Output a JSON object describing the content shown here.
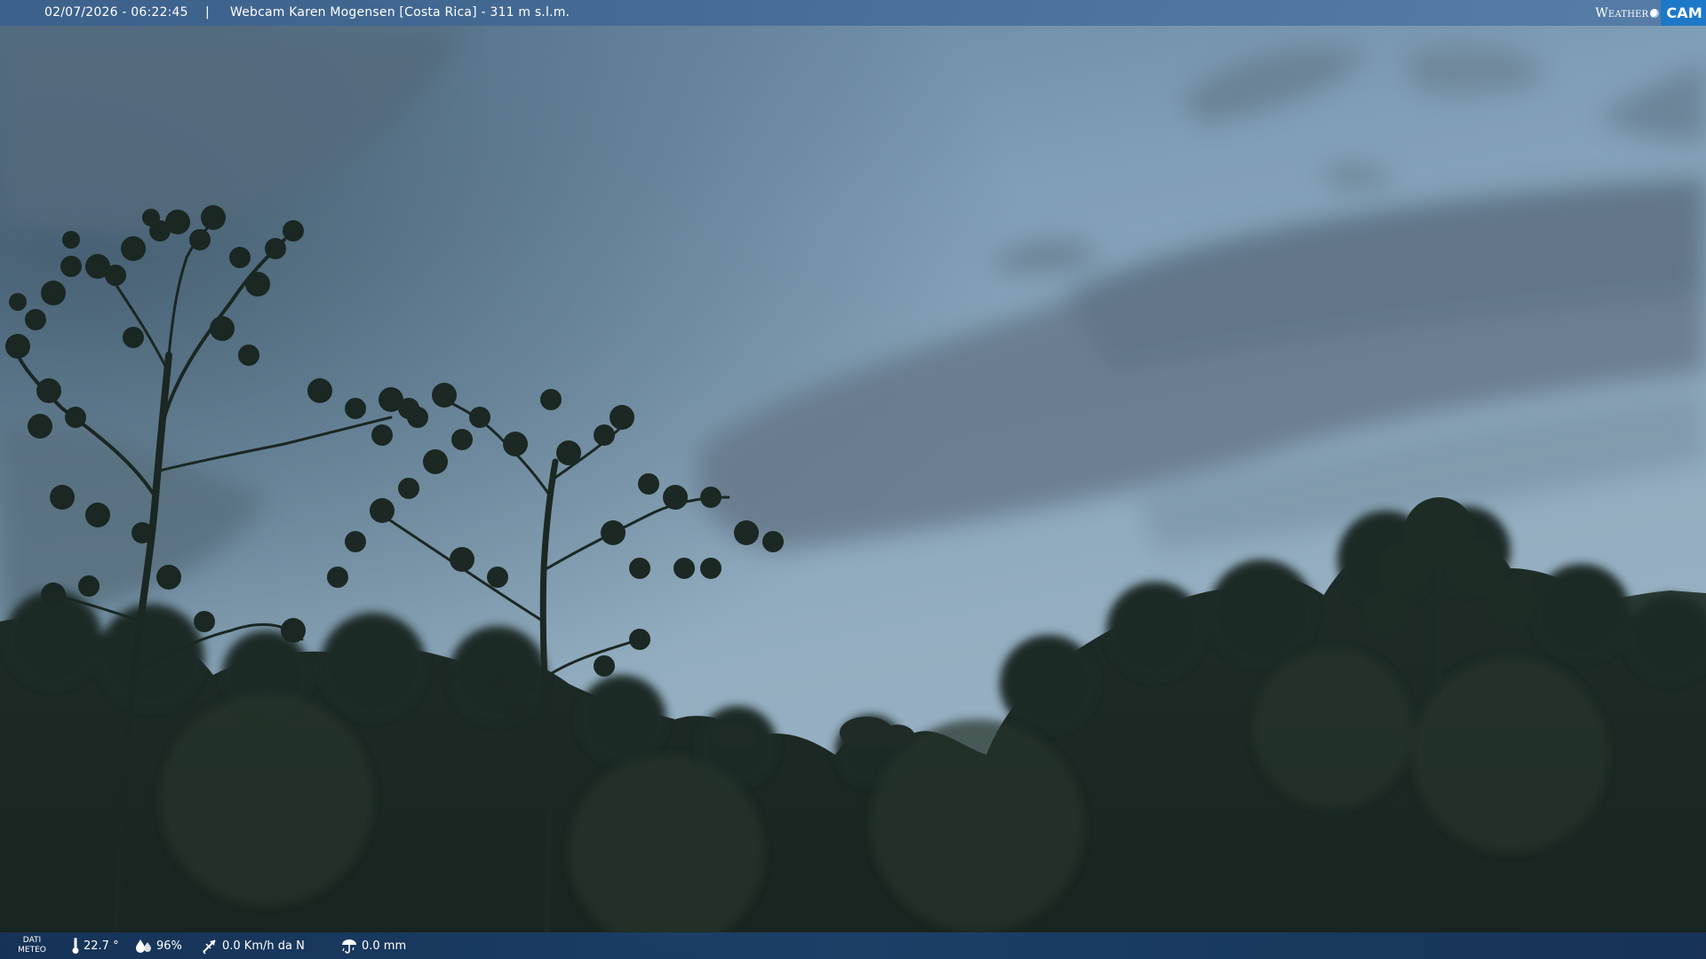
{
  "overlay": {
    "datetime": "02/07/2026 - 06:22:45",
    "separator": "|",
    "title": "Webcam Karen Mogensen [Costa Rica]  - 311 m s.l.m.",
    "logo": {
      "word": "Weather",
      "badge": "CAM"
    }
  },
  "weather": {
    "section_label_line1": "DATI",
    "section_label_line2": "METEO",
    "temperature": "22.7 °",
    "humidity": "96%",
    "wind": "0.0 Km/h da N",
    "rain": "0.0 mm",
    "icons": [
      "thermometer-icon",
      "humidity-drops-icon",
      "wind-vane-icon",
      "rain-gauge-icon"
    ]
  },
  "colors": {
    "top_bar": "#466e9b",
    "bottom_bar": "#1c426e",
    "logo_badge": "#1e78c8"
  }
}
